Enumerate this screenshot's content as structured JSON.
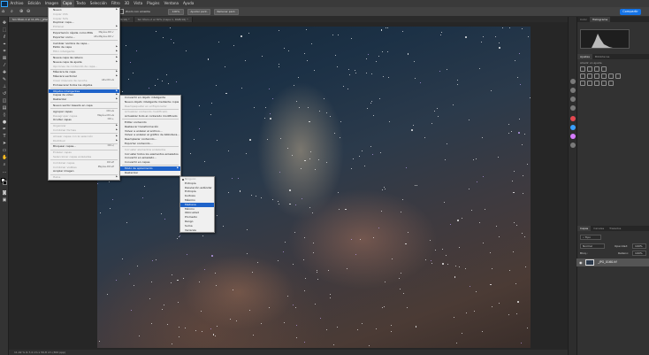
{
  "app": {
    "menubar": [
      "Archivo",
      "Edición",
      "Imagen",
      "Capa",
      "Texto",
      "Selección",
      "Filtro",
      "3D",
      "Vista",
      "Plugins",
      "Ventana",
      "Ayuda"
    ],
    "active_menu": "Capa"
  },
  "options": {
    "zoom_to_fit": "Ajustar a la pantalla",
    "btn1": "Zoom con arrastre",
    "btn2": "100%",
    "btn3": "Ajustar pant.",
    "btn4": "Rellenar pant.",
    "share": "Compartir"
  },
  "doc_tabs": [
    {
      "label": "Sin título-1 al 11,4% (_JPG0160, RGB/16) *",
      "active": true
    },
    {
      "label": "Sin título-3 al 33,3% (Capa 0, RGB/16) *",
      "active": false
    },
    {
      "label": "Sin título-2 al 30% (Capa 1, RGB/16) *",
      "active": false
    }
  ],
  "status": "11,42 %   6.7,4 cm x 50,8 cm (300 ppp)",
  "right_panel": {
    "top_tabs": [
      "Color",
      "Histograma"
    ],
    "adjust_tabs": [
      "Ajustes",
      "Bibliotecas"
    ],
    "adjust_label": "Añadir un ajuste",
    "layer_tabs": [
      "Capas",
      "Canales",
      "Trazados"
    ],
    "search_label": "Tipo",
    "blend_mode": "Normal",
    "opacity_label": "Opacidad:",
    "opacity_value": "100%",
    "fill_label": "Relleno:",
    "fill_value": "100%",
    "lock_label": "Bloq.:",
    "layer_name": "_JPG_0160.tif"
  },
  "capa_menu": [
    {
      "label": "Nuevo",
      "arrow": true
    },
    {
      "label": "Copiar CSS",
      "disabled": true
    },
    {
      "label": "Copiar SVG",
      "disabled": true
    },
    {
      "label": "Duplicar capa...",
      "disabled": false
    },
    {
      "label": "Eliminar",
      "arrow": true,
      "disabled": true
    },
    {
      "sep": true
    },
    {
      "label": "Exportación rápida como PNG",
      "shortcut": "Mayús+Ctrl+'"
    },
    {
      "label": "Exportar como...",
      "shortcut": "Alt+Mayús+Ctrl+'"
    },
    {
      "sep": true
    },
    {
      "label": "Cambiar nombre de capa..."
    },
    {
      "label": "Estilo de capa",
      "arrow": true
    },
    {
      "label": "Filtro inteligente",
      "arrow": true,
      "disabled": true
    },
    {
      "sep": true
    },
    {
      "label": "Nueva capa de relleno",
      "arrow": true
    },
    {
      "label": "Nueva capa de ajuste",
      "arrow": true
    },
    {
      "label": "Opciones de contenido de capa...",
      "disabled": true
    },
    {
      "sep": true
    },
    {
      "label": "Máscara de capa",
      "arrow": true
    },
    {
      "label": "Máscara vectorial",
      "arrow": true
    },
    {
      "label": "Crear máscara de recorte",
      "shortcut": "Alt+Ctrl+G",
      "disabled": true
    },
    {
      "label": "Enmascarar todos los objetos"
    },
    {
      "sep": true
    },
    {
      "label": "Objetos inteligentes",
      "arrow": true,
      "highlight": true
    },
    {
      "label": "Capas de vídeo",
      "arrow": true
    },
    {
      "label": "Rasterizar",
      "arrow": true
    },
    {
      "sep": true
    },
    {
      "label": "Nuevo sector basado en capa"
    },
    {
      "sep": true
    },
    {
      "label": "Agrupar capas",
      "shortcut": "Ctrl+G"
    },
    {
      "label": "Desagrupar capas",
      "shortcut": "Mayús+Ctrl+G",
      "disabled": true
    },
    {
      "label": "Ocultar capas",
      "shortcut": "Ctrl+,"
    },
    {
      "sep": true
    },
    {
      "label": "Organizar",
      "arrow": true,
      "disabled": true
    },
    {
      "label": "Combinar formas",
      "arrow": true,
      "disabled": true
    },
    {
      "sep": true
    },
    {
      "label": "Alinear capas con la selección",
      "arrow": true,
      "disabled": true
    },
    {
      "label": "Distribuir",
      "arrow": true,
      "disabled": true
    },
    {
      "sep": true
    },
    {
      "label": "Bloquear capas...",
      "shortcut": "Ctrl+/"
    },
    {
      "sep": true
    },
    {
      "label": "Enlazar capas",
      "disabled": true
    },
    {
      "label": "Seleccionar capas enlazadas",
      "disabled": true
    },
    {
      "sep": true
    },
    {
      "label": "Combinar capas",
      "shortcut": "Ctrl+E",
      "disabled": true
    },
    {
      "label": "Combinar visibles",
      "shortcut": "Mayús+Ctrl+E",
      "disabled": true
    },
    {
      "label": "Acoplar imagen"
    },
    {
      "sep": true
    },
    {
      "label": "Halos",
      "arrow": true,
      "disabled": true
    }
  ],
  "smart_menu": [
    {
      "label": "Convertir en objeto inteligente"
    },
    {
      "label": "Nuevo objeto inteligente mediante copia"
    },
    {
      "label": "Reempaquetar en el Explorador",
      "disabled": true
    },
    {
      "sep": true
    },
    {
      "label": "Actualizar contenido modificado",
      "disabled": true
    },
    {
      "label": "Actualizar todo el contenido modificado"
    },
    {
      "sep": true
    },
    {
      "label": "Editar contenido"
    },
    {
      "label": "Restaurar transformación"
    },
    {
      "label": "Volver a enlazar al archivo..."
    },
    {
      "label": "Volver a enlazar al gráfico de biblioteca..."
    },
    {
      "label": "Reemplazar contenido..."
    },
    {
      "label": "Exportar contenido..."
    },
    {
      "sep": true
    },
    {
      "label": "Incrustar elementos enlazados",
      "disabled": true
    },
    {
      "label": "Incrustar todos los elementos enlazados"
    },
    {
      "label": "Convertir en enlazado..."
    },
    {
      "label": "Convertir en capas"
    },
    {
      "sep": true
    },
    {
      "label": "Modo de apilamiento",
      "arrow": true,
      "highlight": true
    },
    {
      "label": "Rasterizar"
    }
  ],
  "stack_menu": [
    {
      "label": "Ninguno",
      "disabled": true,
      "bullet": true
    },
    {
      "label": "Entropía"
    },
    {
      "label": "Desviación estándar"
    },
    {
      "label": "Entropía"
    },
    {
      "label": "Kurtosis"
    },
    {
      "label": "Máximo"
    },
    {
      "label": "Mediana",
      "highlight": true
    },
    {
      "label": "Mínimo"
    },
    {
      "label": "Oblicuidad"
    },
    {
      "label": "Promedio"
    },
    {
      "label": "Rango"
    },
    {
      "label": "Suma"
    },
    {
      "label": "Varianza"
    }
  ],
  "colors": {
    "menu_bg": "#f0f0f0",
    "highlight": "#1f63c9",
    "share": "#1473e6"
  }
}
